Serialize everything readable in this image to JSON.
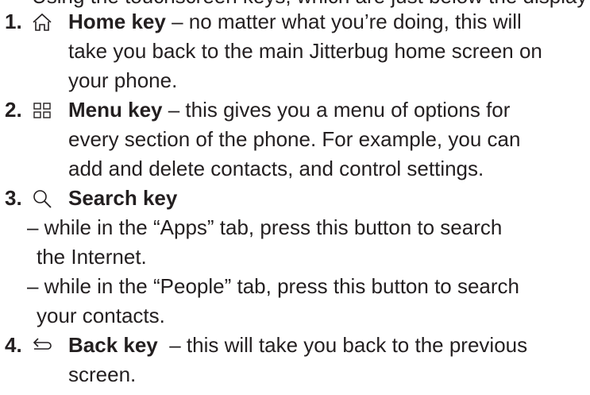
{
  "clipped_top": "Using the touchscreen keys, which are just below the display",
  "items": [
    {
      "number": "1.",
      "icon": "home-icon",
      "key": "Home key",
      "lines": [
        " – no matter what you’re doing, this will",
        "take you back to the main Jitterbug home screen on",
        "your phone."
      ]
    },
    {
      "number": "2.",
      "icon": "menu-icon",
      "key": "Menu key",
      "lines": [
        " – this gives you a menu of options for",
        "every section of the phone. For example, you can",
        "add and delete contacts, and control settings."
      ]
    },
    {
      "number": "3.",
      "icon": "search-icon",
      "key": "Search key",
      "lines": [
        "– while in the “Apps” tab,  press this button to search",
        "the Internet.",
        "– while in the “People” tab, press this button to search",
        "your contacts."
      ]
    },
    {
      "number": "4.",
      "icon": "back-icon",
      "key": "Back key",
      "lines": [
        "  – this will take you back to the previous",
        "screen."
      ]
    }
  ]
}
